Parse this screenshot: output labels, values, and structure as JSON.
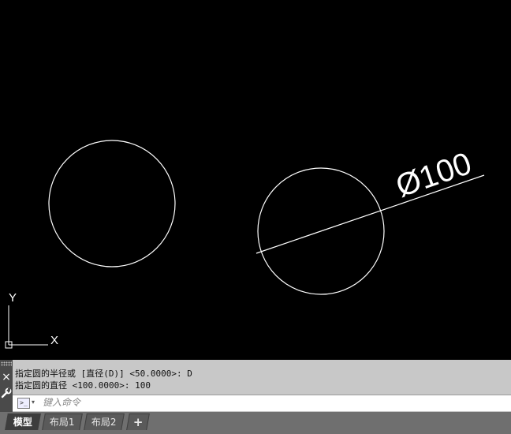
{
  "canvas": {
    "background": "#000000",
    "dimension_text": "Ø100",
    "ucs": {
      "x_label": "X",
      "y_label": "Y"
    }
  },
  "command_panel": {
    "history": [
      "指定圆的半径或 [直径(D)] <50.0000>: D",
      "指定圆的直径 <100.0000>: 100"
    ],
    "input_placeholder": "键入命令",
    "close_icon": "×"
  },
  "tabs": {
    "model": "模型",
    "layout1": "布局1",
    "layout2": "布局2",
    "add": "+"
  }
}
